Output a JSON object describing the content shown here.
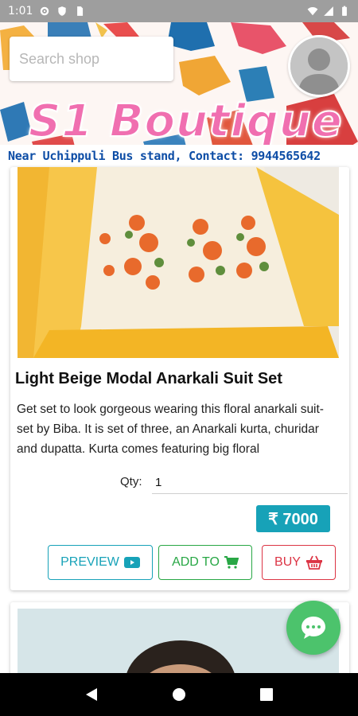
{
  "status_bar": {
    "time": "1:01",
    "icons": [
      "gear-icon",
      "shield-icon",
      "sim-card-icon",
      "wifi-icon",
      "signal-icon",
      "battery-icon"
    ]
  },
  "header": {
    "search_placeholder": "Search shop",
    "brand_title": "S1 Boutique",
    "tagline": "Near Uchippuli Bus stand, Contact: 9944565642"
  },
  "product": {
    "name": "Light Beige Modal Anarkali Suit Set",
    "description": "Get set to look gorgeous wearing this floral anarkali suit-set by Biba. It is set of three, an Anarkali kurta, churidar and dupatta. Kurta comes featuring big floral",
    "qty_label": "Qty:",
    "qty_value": "1",
    "price": "₹ 7000",
    "buttons": {
      "preview": "PREVIEW",
      "add_to": "ADD TO",
      "buy": "BUY"
    }
  },
  "colors": {
    "accent_teal": "#17a2b8",
    "accent_green": "#28a745",
    "accent_red": "#dc3545",
    "search_red": "#ee1c25",
    "brand_pink": "#f06fb0",
    "tagline_blue": "#0d4da6",
    "chat_green": "#4cc36c"
  }
}
